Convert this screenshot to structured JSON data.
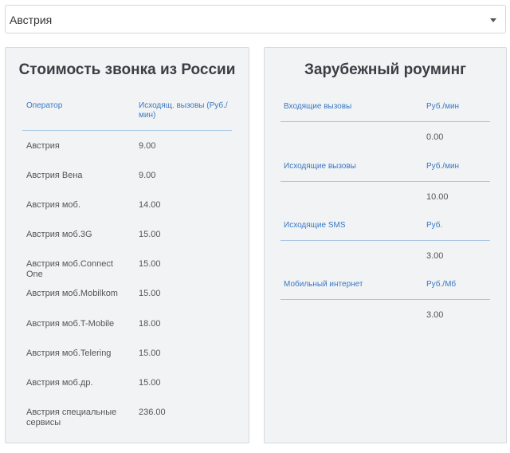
{
  "selector": {
    "value": "Австрия",
    "icon": "chevron-down-icon"
  },
  "calls_from_russia": {
    "title": "Стоимость звонка из России",
    "col_operator": "Оператор",
    "col_outgoing": "Исходящ. вызовы (Руб./ мин)",
    "rows": [
      {
        "operator": "Австрия",
        "price": "9.00"
      },
      {
        "operator": "Австрия Вена",
        "price": "9.00"
      },
      {
        "operator": "Австрия моб.",
        "price": "14.00"
      },
      {
        "operator": "Австрия моб.3G",
        "price": "15.00"
      },
      {
        "operator": "Австрия моб.Connect One",
        "price": "15.00"
      },
      {
        "operator": "Австрия моб.Mobilkom",
        "price": "15.00"
      },
      {
        "operator": "Австрия моб.T-Mobile",
        "price": "18.00"
      },
      {
        "operator": "Австрия моб.Telering",
        "price": "15.00"
      },
      {
        "operator": "Австрия моб.др.",
        "price": "15.00"
      },
      {
        "operator": "Австрия специальные сервисы",
        "price": "236.00"
      }
    ]
  },
  "roaming": {
    "title": "Зарубежный роуминг",
    "items": [
      {
        "label": "Входящие вызовы",
        "unit": "Руб./мин",
        "value": "0.00"
      },
      {
        "label": "Исходящие вызовы",
        "unit": "Руб./мин",
        "value": "10.00"
      },
      {
        "label": "Исходящие SMS",
        "unit": "Руб.",
        "value": "3.00"
      },
      {
        "label": "Мобильный интернет",
        "unit": "Руб./Мб",
        "value": "3.00"
      }
    ]
  },
  "colors": {
    "accent": "#3a78c2",
    "panel_bg": "#f1f3f5",
    "divider": "#a9c6e3"
  }
}
